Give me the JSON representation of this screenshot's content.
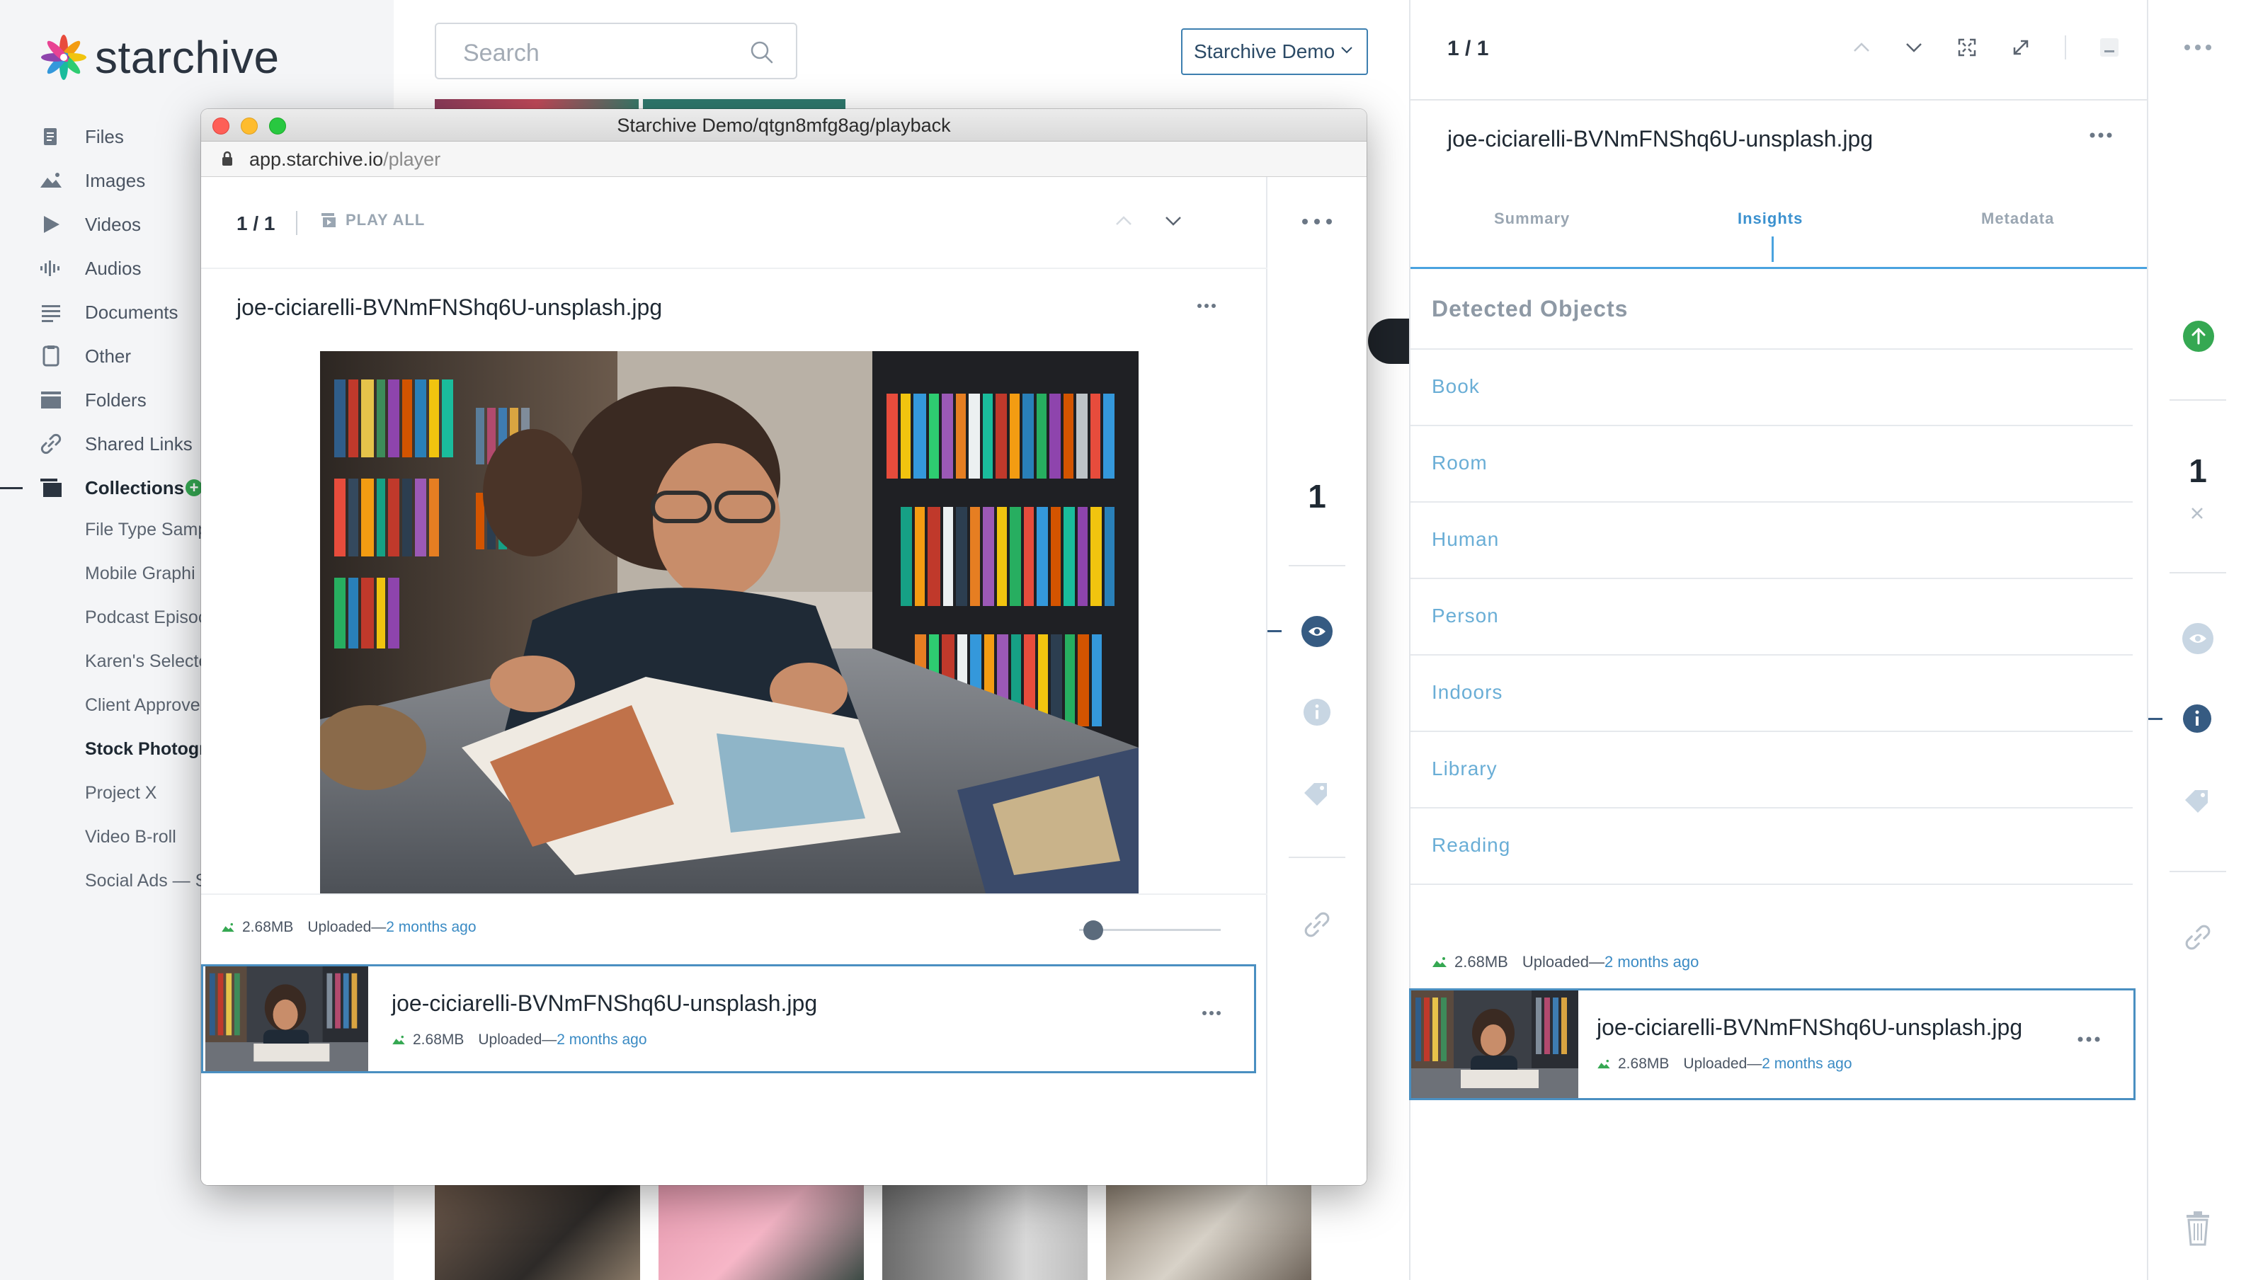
{
  "brand": {
    "name": "starchive"
  },
  "search": {
    "placeholder": "Search"
  },
  "workspace": {
    "label": "Starchive Demo"
  },
  "sidebar": {
    "items": [
      {
        "label": "Files",
        "icon": "files-icon"
      },
      {
        "label": "Images",
        "icon": "images-icon"
      },
      {
        "label": "Videos",
        "icon": "videos-icon"
      },
      {
        "label": "Audios",
        "icon": "audios-icon"
      },
      {
        "label": "Documents",
        "icon": "documents-icon"
      },
      {
        "label": "Other",
        "icon": "other-icon"
      },
      {
        "label": "Folders",
        "icon": "folders-icon"
      },
      {
        "label": "Shared Links",
        "icon": "link-icon"
      },
      {
        "label": "Collections",
        "icon": "collections-icon"
      }
    ],
    "collections": [
      "File Type Samp",
      "Mobile Graphi",
      "Podcast Episoc",
      "Karen's Selecte",
      "Client Approve",
      "Stock Photogr",
      "Project X",
      "Video B-roll",
      "Social Ads — So"
    ]
  },
  "window": {
    "title": "Starchive Demo/qtgn8mfg8ag/playback",
    "url_domain": "app.starchive.io",
    "url_path": "/player"
  },
  "player": {
    "count": "1 / 1",
    "play_all": "PLAY ALL",
    "filename": "joe-ciciarelli-BVNmFNShq6U-unsplash.jpg",
    "size": "2.68MB",
    "uploaded_label": "Uploaded—",
    "uploaded_when": "2 months ago",
    "zoom_level": 0.1,
    "rail_count": "1"
  },
  "queue": {
    "filename": "joe-ciciarelli-BVNmFNShq6U-unsplash.jpg",
    "size": "2.68MB",
    "uploaded_label": "Uploaded—",
    "uploaded_when": "2 months ago"
  },
  "detail": {
    "count": "1 / 1",
    "filename": "joe-ciciarelli-BVNmFNShq6U-unsplash.jpg",
    "tabs": [
      "Summary",
      "Insights",
      "Metadata"
    ],
    "active_tab": "Insights",
    "detected_title": "Detected Objects",
    "objects": [
      "Book",
      "Room",
      "Human",
      "Person",
      "Indoors",
      "Library",
      "Reading"
    ],
    "size": "2.68MB",
    "uploaded_label": "Uploaded—",
    "uploaded_when": "2 months ago"
  },
  "detail_card": {
    "filename": "joe-ciciarelli-BVNmFNShq6U-unsplash.jpg",
    "size": "2.68MB",
    "uploaded_label": "Uploaded—",
    "uploaded_when": "2 months ago"
  },
  "rail": {
    "count": "1"
  },
  "colors": {
    "accent": "#3b8bc4",
    "green": "#35a852",
    "active_eye": "#365b82"
  }
}
